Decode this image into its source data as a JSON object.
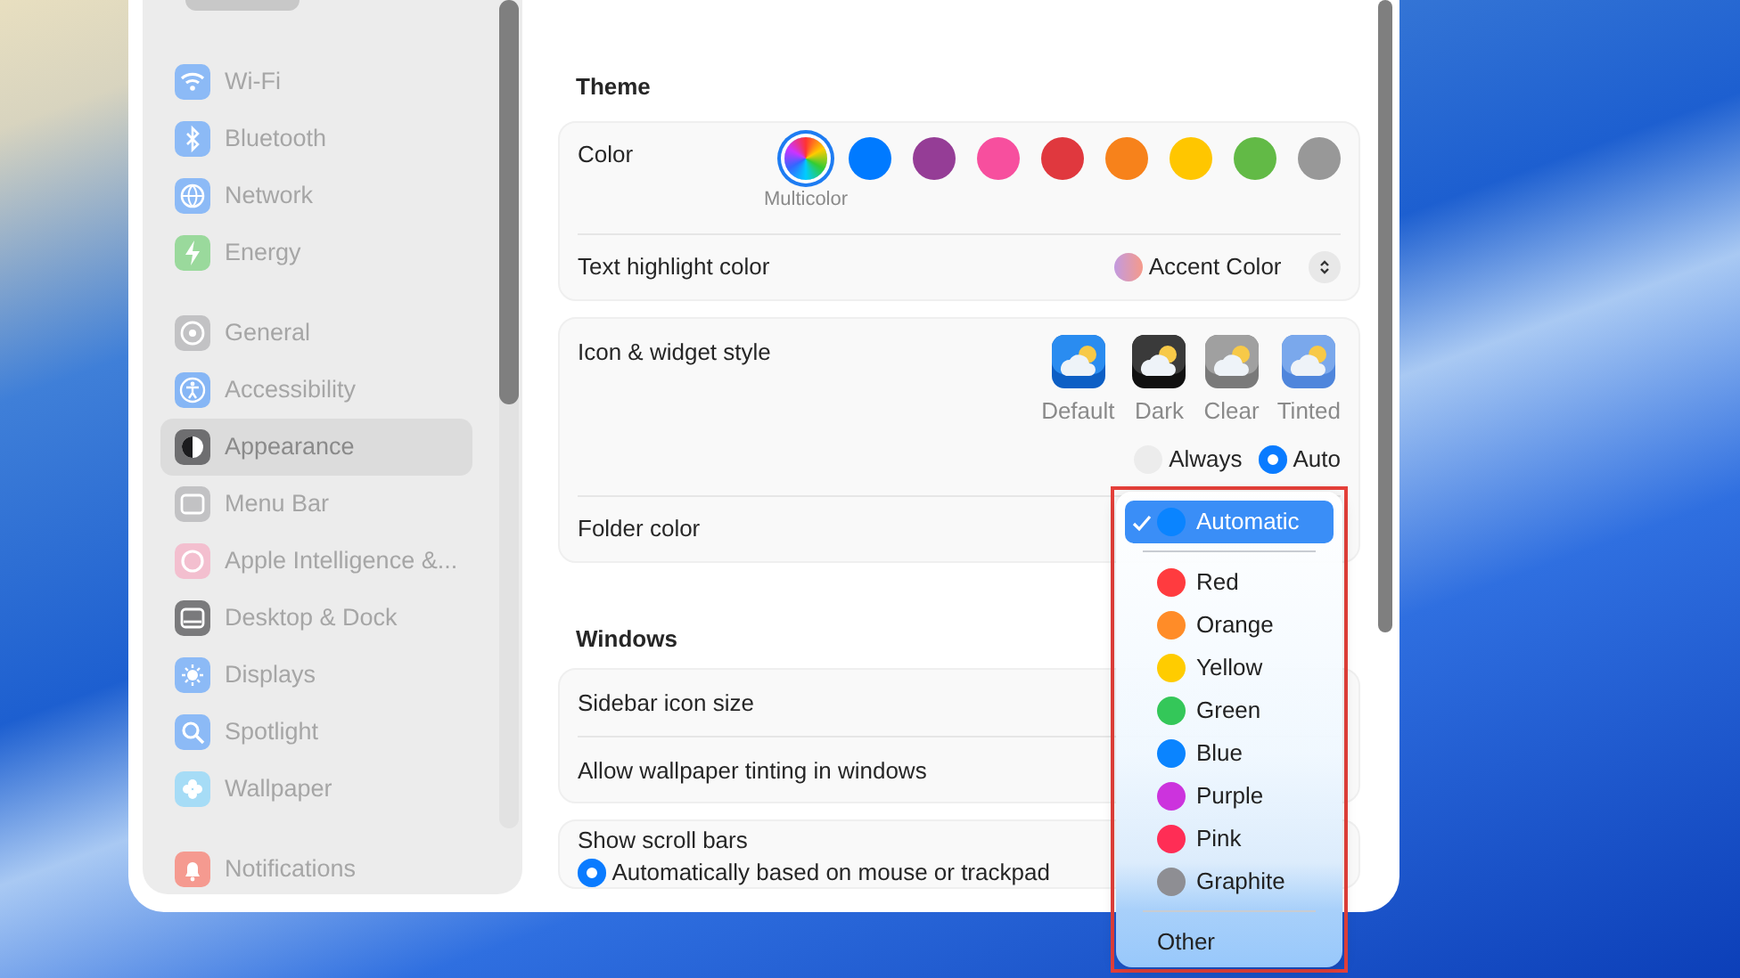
{
  "sidebar": {
    "groups": [
      [
        {
          "label": "Wi-Fi",
          "color": "#8cbaf6",
          "selected": false
        },
        {
          "label": "Bluetooth",
          "color": "#8cbaf6",
          "selected": false
        },
        {
          "label": "Network",
          "color": "#8cbaf6",
          "selected": false
        },
        {
          "label": "Energy",
          "color": "#9ad99c",
          "selected": false
        }
      ],
      [
        {
          "label": "General",
          "color": "#c2c2c4",
          "selected": false
        },
        {
          "label": "Accessibility",
          "color": "#86b6f5",
          "selected": false
        },
        {
          "label": "Appearance",
          "color": "#6e6e70",
          "selected": true
        },
        {
          "label": "Menu Bar",
          "color": "#c2c2c4",
          "selected": false
        },
        {
          "label": "Apple Intelligence &...",
          "color": "#f3bfcf",
          "selected": false
        },
        {
          "label": "Desktop & Dock",
          "color": "#7a7a7c",
          "selected": false
        },
        {
          "label": "Displays",
          "color": "#8cbaf6",
          "selected": false
        },
        {
          "label": "Spotlight",
          "color": "#8cbaf6",
          "selected": false
        },
        {
          "label": "Wallpaper",
          "color": "#a6dcf6",
          "selected": false
        }
      ],
      [
        {
          "label": "Notifications",
          "color": "#f59a90",
          "selected": false
        }
      ]
    ]
  },
  "sections": [
    {
      "heading": "Theme",
      "cards": [
        [
          {
            "kind": "swatches",
            "label": "Color",
            "swatches": [
              {
                "kind": "multicolor",
                "label": "Multicolor",
                "selected": true
              },
              {
                "kind": "solid",
                "color": "#007aff",
                "selected": false
              },
              {
                "kind": "solid",
                "color": "#953d96",
                "selected": false
              },
              {
                "kind": "solid",
                "color": "#f74f9e",
                "selected": false
              },
              {
                "kind": "solid",
                "color": "#e0383e",
                "selected": false
              },
              {
                "kind": "solid",
                "color": "#f7821b",
                "selected": false
              },
              {
                "kind": "solid",
                "color": "#ffc600",
                "selected": false
              },
              {
                "kind": "solid",
                "color": "#62ba46",
                "selected": false
              },
              {
                "kind": "solid",
                "color": "#989898",
                "selected": false
              }
            ]
          },
          {
            "kind": "popup",
            "label": "Text highlight color",
            "value": "Accent Color"
          }
        ],
        [
          {
            "kind": "icon_styles",
            "label": "Icon & widget style",
            "styles": [
              {
                "kind": "default",
                "label": "Default"
              },
              {
                "kind": "dark",
                "label": "Dark"
              },
              {
                "kind": "clear",
                "label": "Clear"
              },
              {
                "kind": "tinted",
                "label": "Tinted"
              }
            ],
            "options": [
              {
                "label": "Always",
                "selected": false
              },
              {
                "label": "Auto",
                "selected": true
              }
            ]
          },
          {
            "kind": "plain",
            "label": "Folder color"
          }
        ]
      ]
    },
    {
      "heading": "Windows",
      "cards": [
        [
          {
            "kind": "plain",
            "label": "Sidebar icon size"
          },
          {
            "kind": "plain",
            "label": "Allow wallpaper tinting in windows"
          }
        ],
        [
          {
            "kind": "radio",
            "label": "Show scroll bars",
            "options": [
              {
                "label": "Automatically based on mouse or trackpad",
                "selected": true
              }
            ]
          }
        ]
      ]
    }
  ],
  "menu": {
    "items": [
      {
        "kind": "color",
        "label": "Automatic",
        "color": "#0a84ff",
        "selected": true
      },
      {
        "kind": "separator"
      },
      {
        "kind": "color",
        "label": "Red",
        "color": "#ff3b3f",
        "selected": false
      },
      {
        "kind": "color",
        "label": "Orange",
        "color": "#ff8c28",
        "selected": false
      },
      {
        "kind": "color",
        "label": "Yellow",
        "color": "#ffcc00",
        "selected": false
      },
      {
        "kind": "color",
        "label": "Green",
        "color": "#34c759",
        "selected": false
      },
      {
        "kind": "color",
        "label": "Blue",
        "color": "#0a84ff",
        "selected": false
      },
      {
        "kind": "color",
        "label": "Purple",
        "color": "#cc33dd",
        "selected": false
      },
      {
        "kind": "color",
        "label": "Pink",
        "color": "#ff2d55",
        "selected": false
      },
      {
        "kind": "color",
        "label": "Graphite",
        "color": "#8e8e93",
        "selected": false
      },
      {
        "kind": "separator"
      },
      {
        "kind": "plain",
        "label": "Other",
        "selected": false
      }
    ]
  }
}
